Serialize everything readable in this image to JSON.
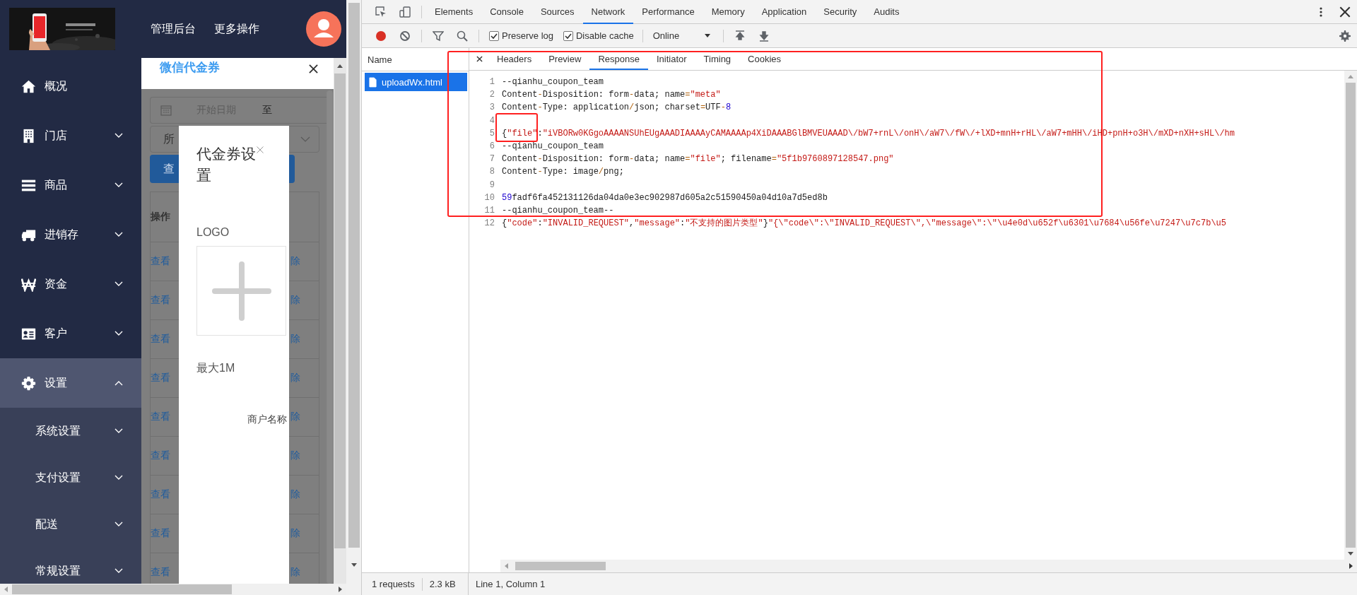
{
  "app": {
    "header_links": [
      "管理后台",
      "更多操作"
    ],
    "sidebar": {
      "items": [
        {
          "label": "概况",
          "kind": "link",
          "selected": false
        },
        {
          "label": "门店",
          "kind": "group",
          "expanded": false,
          "selected": false
        },
        {
          "label": "商品",
          "kind": "group",
          "expanded": false,
          "selected": false
        },
        {
          "label": "进销存",
          "kind": "group",
          "expanded": false,
          "selected": false
        },
        {
          "label": "资金",
          "kind": "group",
          "expanded": false,
          "selected": false
        },
        {
          "label": "客户",
          "kind": "group",
          "expanded": false,
          "selected": false
        },
        {
          "label": "设置",
          "kind": "group",
          "expanded": true,
          "selected": true,
          "children": [
            {
              "label": "系统设置",
              "expanded": false
            },
            {
              "label": "支付设置",
              "expanded": false
            },
            {
              "label": "配送",
              "expanded": false
            },
            {
              "label": "常规设置",
              "expanded": false
            }
          ]
        }
      ]
    },
    "panel": {
      "title": "微信代金券"
    },
    "filters": {
      "placeholder": "开始日期",
      "range_separator": "至",
      "select_value": "所",
      "query_button": "查"
    },
    "table": {
      "header": "操作",
      "rows": [
        {
          "column_1": "查看",
          "column_2": "除"
        },
        {
          "column_1": "查看",
          "column_2": "除"
        },
        {
          "column_1": "查看",
          "column_2": "除"
        },
        {
          "column_1": "查看",
          "column_2": "除"
        },
        {
          "column_1": "查看",
          "column_2": "除"
        },
        {
          "column_1": "查看",
          "column_2": "除"
        },
        {
          "column_1": "查看",
          "column_2": "除"
        },
        {
          "column_1": "查看",
          "column_2": "除"
        },
        {
          "column_1": "查看",
          "column_2": "除"
        }
      ]
    },
    "dialog": {
      "title": "代金券设置",
      "logo_label": "LOGO",
      "size_hint": "最大1M",
      "merchant_label": "商户名称"
    }
  },
  "devtools": {
    "tabs": [
      {
        "label": "Elements",
        "selected": false
      },
      {
        "label": "Console",
        "selected": false
      },
      {
        "label": "Sources",
        "selected": false
      },
      {
        "label": "Network",
        "selected": true
      },
      {
        "label": "Performance",
        "selected": false
      },
      {
        "label": "Memory",
        "selected": false
      },
      {
        "label": "Application",
        "selected": false
      },
      {
        "label": "Security",
        "selected": false
      },
      {
        "label": "Audits",
        "selected": false
      }
    ],
    "toolbar": {
      "preserve_log": {
        "label": "Preserve log",
        "checked": true
      },
      "disable_cache": {
        "label": "Disable cache",
        "checked": true
      },
      "throttling": "Online"
    },
    "requests": {
      "header": "Name",
      "items": [
        {
          "name": "uploadWx.html",
          "selected": true
        }
      ]
    },
    "detail_tabs": [
      {
        "label": "Headers",
        "selected": false
      },
      {
        "label": "Preview",
        "selected": false
      },
      {
        "label": "Response",
        "selected": true
      },
      {
        "label": "Initiator",
        "selected": false
      },
      {
        "label": "Timing",
        "selected": false
      },
      {
        "label": "Cookies",
        "selected": false
      }
    ],
    "response": {
      "lines": [
        {
          "number": "1",
          "tokens": [
            {
              "kind": "plain",
              "text": "--qianhu_coupon_team"
            }
          ]
        },
        {
          "number": "2",
          "tokens": [
            {
              "kind": "plain",
              "text": "Content"
            },
            {
              "kind": "op",
              "text": "-"
            },
            {
              "kind": "plain",
              "text": "Disposition: form"
            },
            {
              "kind": "op",
              "text": "-"
            },
            {
              "kind": "plain",
              "text": "data; name"
            },
            {
              "kind": "op",
              "text": "="
            },
            {
              "kind": "string",
              "text": "\"meta\""
            }
          ]
        },
        {
          "number": "3",
          "tokens": [
            {
              "kind": "plain",
              "text": "Content"
            },
            {
              "kind": "op",
              "text": "-"
            },
            {
              "kind": "plain",
              "text": "Type: application"
            },
            {
              "kind": "op",
              "text": "/"
            },
            {
              "kind": "plain",
              "text": "json; charset"
            },
            {
              "kind": "op",
              "text": "="
            },
            {
              "kind": "plain",
              "text": "UTF"
            },
            {
              "kind": "op",
              "text": "-"
            },
            {
              "kind": "number",
              "text": "8"
            }
          ]
        },
        {
          "number": "4"
        },
        {
          "number": "5",
          "tokens": [
            {
              "kind": "plain",
              "text": "{"
            },
            {
              "kind": "string",
              "text": "\"file\""
            },
            {
              "kind": "plain",
              "text": ":"
            },
            {
              "kind": "string",
              "text": "\"iVBORw0KGgoAAAANSUhEUgAAADIAAAAyCAMAAAAp4XiDAAABGlBMVEUAAAD\\/bW7+rnL\\/onH\\/aW7\\/fW\\/+lXD+mnH+rHL\\/aW7+mHH\\/iHD+pnH+o3H\\/mXD+nXH+sHL\\/hm"
            }
          ]
        },
        {
          "number": "6",
          "tokens": [
            {
              "kind": "plain",
              "text": "--qianhu_coupon_team"
            }
          ]
        },
        {
          "number": "7",
          "tokens": [
            {
              "kind": "plain",
              "text": "Content"
            },
            {
              "kind": "op",
              "text": "-"
            },
            {
              "kind": "plain",
              "text": "Disposition: form"
            },
            {
              "kind": "op",
              "text": "-"
            },
            {
              "kind": "plain",
              "text": "data; name"
            },
            {
              "kind": "op",
              "text": "="
            },
            {
              "kind": "string",
              "text": "\"file\""
            },
            {
              "kind": "plain",
              "text": "; filename"
            },
            {
              "kind": "op",
              "text": "="
            },
            {
              "kind": "string",
              "text": "\"5f1b9760897128547.png\""
            }
          ]
        },
        {
          "number": "8",
          "tokens": [
            {
              "kind": "plain",
              "text": "Content"
            },
            {
              "kind": "op",
              "text": "-"
            },
            {
              "kind": "plain",
              "text": "Type: image"
            },
            {
              "kind": "op",
              "text": "/"
            },
            {
              "kind": "plain",
              "text": "png;"
            }
          ]
        },
        {
          "number": "9"
        },
        {
          "number": "10",
          "tokens": [
            {
              "kind": "number",
              "text": "59"
            },
            {
              "kind": "plain",
              "text": "fadf6fa452131126da04da0e3ec902987d605a2c51590450a04d10a7d5ed8b"
            }
          ]
        },
        {
          "number": "11",
          "tokens": [
            {
              "kind": "plain",
              "text": "--qianhu_coupon_team--"
            }
          ]
        },
        {
          "number": "12",
          "tokens": [
            {
              "kind": "plain",
              "text": "{"
            },
            {
              "kind": "string",
              "text": "\"code\""
            },
            {
              "kind": "plain",
              "text": ":"
            },
            {
              "kind": "string",
              "text": "\"INVALID_REQUEST\""
            },
            {
              "kind": "plain",
              "text": ","
            },
            {
              "kind": "string",
              "text": "\"message\""
            },
            {
              "kind": "plain",
              "text": ":"
            },
            {
              "kind": "string",
              "text": "\"不支持的图片类型\""
            },
            {
              "kind": "plain",
              "text": "}"
            },
            {
              "kind": "string",
              "text": "\"{\\\"code\\\":\\\"INVALID_REQUEST\\\",\\\"message\\\":\\\"\\u4e0d\\u652f\\u6301\\u7684\\u56fe\\u7247\\u7c7b\\u5"
            }
          ]
        }
      ]
    },
    "status": {
      "requests": "1 requests",
      "size": "2.3 kB",
      "cursor": "Line 1, Column 1"
    }
  }
}
